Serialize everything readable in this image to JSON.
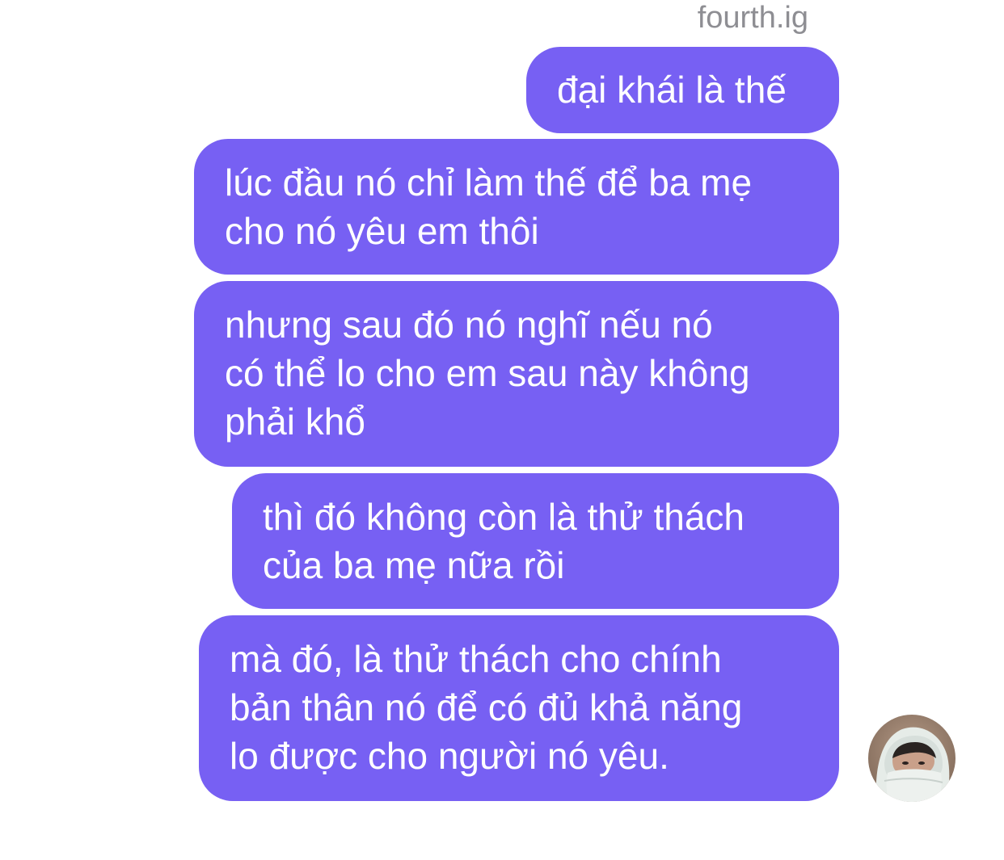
{
  "conversation": {
    "sender_name": "fourth.ig",
    "messages": [
      {
        "text": "đại khái là thế"
      },
      {
        "text": "lúc đầu nó chỉ làm thế để ba mẹ\ncho nó yêu em thôi"
      },
      {
        "text": "nhưng sau đó nó nghĩ nếu nó\ncó thể lo cho em sau này không\nphải khổ"
      },
      {
        "text": "thì đó không còn là thử thách\ncủa ba mẹ nữa rồi"
      },
      {
        "text": "mà đó, là thử thách cho chính\nbản thân nó để có đủ khả năng\nlo được cho người nó yêu."
      }
    ]
  },
  "colors": {
    "bubble": "#7760f3",
    "bubble_text": "#ffffff",
    "sender_label": "#8e8e93"
  },
  "icons": {
    "avatar": "user-avatar-photo"
  }
}
